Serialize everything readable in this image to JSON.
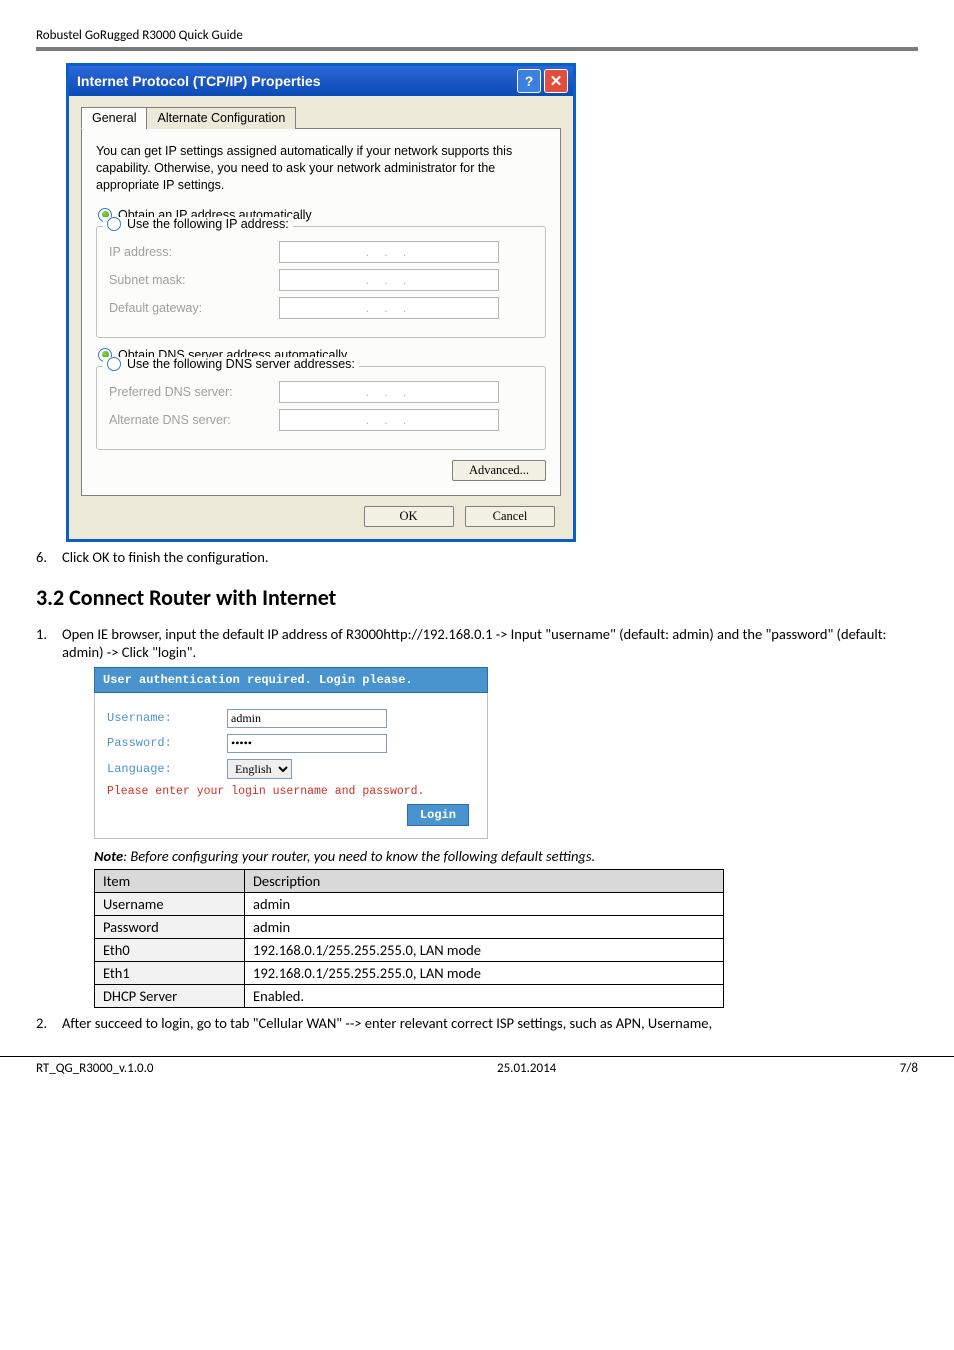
{
  "header": {
    "text": "Robustel GoRugged R3000 Quick Guide"
  },
  "dialog": {
    "title": "Internet Protocol (TCP/IP) Properties",
    "tabs": {
      "general": "General",
      "alt": "Alternate Configuration"
    },
    "desc": "You can get IP settings assigned automatically if your network supports this capability. Otherwise, you need to ask your network administrator for the appropriate IP settings.",
    "radio_ip_auto": "Obtain an IP address automatically",
    "radio_ip_manual": "Use the following IP address:",
    "ip_label": "IP address:",
    "mask_label": "Subnet mask:",
    "gw_label": "Default gateway:",
    "radio_dns_auto": "Obtain DNS server address automatically",
    "radio_dns_manual": "Use the following DNS server addresses:",
    "pref_dns": "Preferred DNS server:",
    "alt_dns": "Alternate DNS server:",
    "advanced_btn": "Advanced...",
    "ok_btn": "OK",
    "cancel_btn": "Cancel"
  },
  "step6": "Click OK to finish the configuration.",
  "h2": "3.2    Connect Router with Internet",
  "step1": "Open IE browser, input the default IP address of R3000http://192.168.0.1 -> Input \"username\" (default: admin) and the \"password\" (default: admin) -> Click \"login\".",
  "login": {
    "title": "User authentication required. Login please.",
    "username_label": "Username:",
    "username_value": "admin",
    "password_label": "Password:",
    "password_value": "•••••",
    "language_label": "Language:",
    "language_value": "English",
    "msg": "Please enter your login username and password.",
    "btn": "Login"
  },
  "note": "Note: Before configuring your router, you need to know the following default settings.",
  "note_prefix": "Note",
  "note_rest": ": Before configuring your router, you need to know the following default settings.",
  "table": {
    "h1": "Item",
    "h2": "Description",
    "rows": [
      {
        "k": "Username",
        "v": "admin"
      },
      {
        "k": "Password",
        "v": "admin"
      },
      {
        "k": "Eth0",
        "v": "192.168.0.1/255.255.255.0, LAN mode"
      },
      {
        "k": "Eth1",
        "v": "192.168.0.1/255.255.255.0, LAN mode"
      },
      {
        "k": "DHCP Server",
        "v": "Enabled."
      }
    ]
  },
  "step2": "After succeed to login, go to tab \"Cellular WAN\" --> enter relevant correct ISP settings, such as APN, Username,",
  "footer": {
    "left": "RT_QG_R3000_v.1.0.0",
    "center": "25.01.2014",
    "right": "7/8"
  }
}
